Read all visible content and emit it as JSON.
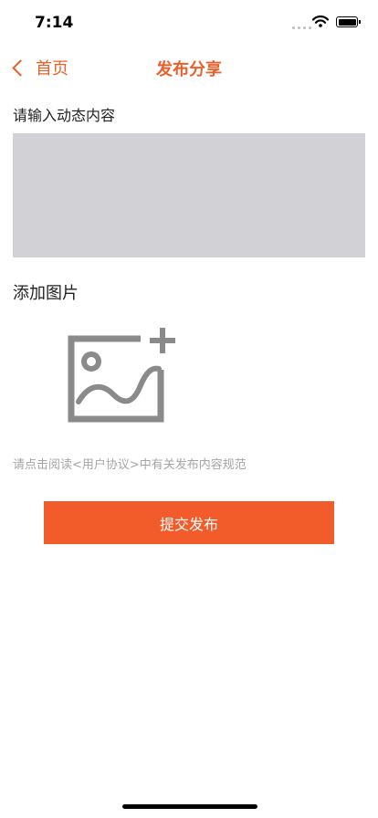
{
  "status_bar": {
    "time": "7:14"
  },
  "nav": {
    "back_label": "首页",
    "title": "发布分享"
  },
  "form": {
    "content_label": "请输入动态内容",
    "content_value": "",
    "image_label": "添加图片",
    "agreement_text": "请点击阅读<用户协议>中有关发布内容规范",
    "submit_label": "提交发布"
  },
  "icons": {
    "back": "chevron-left-icon",
    "add_image": "add-image-icon",
    "wifi": "wifi-icon",
    "battery": "battery-icon",
    "signal": "cellular-signal-icon"
  },
  "colors": {
    "accent": "#e8602a",
    "button_bg": "#f25c2a",
    "input_bg": "#d1d1d6",
    "icon_gray": "#8a8a8a",
    "hint_text": "#a5a5a5"
  }
}
